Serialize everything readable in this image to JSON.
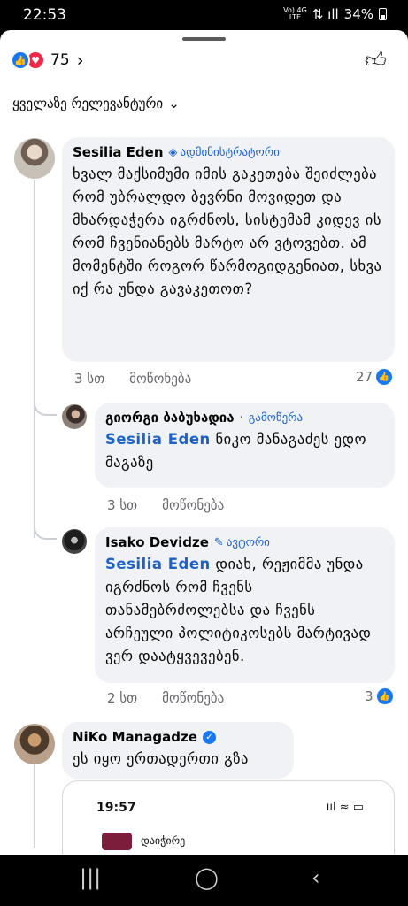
{
  "status_bar": {
    "time": "22:53",
    "net_top": "Vo) 4G",
    "net_bottom": "LTE",
    "battery": "34%"
  },
  "reactions": {
    "count": "75"
  },
  "sort": {
    "label": "ყველაზე რელევანტური"
  },
  "comments": [
    {
      "author": "Sesilia Eden",
      "badge": "ადმინისტრატორი",
      "text": "ხვალ მაქსიმუმი იმის გაკეთება შეიძლება რომ უბრალდო ბევრნი მოვიდეთ და მხარდაჭერა იგრძნოს, სისტემამ კიდევ ის რომ ჩვენიანებს მარტო არ ვტოვებთ. ამ მომენტში როგორ წარმოგიდგენიათ, სხვა იქ რა უნდა გავაკეთოთ?",
      "time": "3 სთ",
      "like": "მოწონება",
      "likes": "27"
    },
    {
      "author": "გიორგი ბაბუხადია",
      "badge": "გამოწერა",
      "mention": "Sesilia Eden",
      "text": " ნიკო მანაგაძეს ედო მაგაზე",
      "time": "3 სთ",
      "like": "მოწონება"
    },
    {
      "author": "Isako Devidze",
      "badge": "ავტორი",
      "mention": "Sesilia Eden",
      "text": " დიახ, რეჟიმმა უნდა იგრძნოს რომ ჩვენს თანამებრძოლებსა და ჩვენს არჩეული პოლიტიკოსებს მარტივად ვერ დაატყვევებენ.",
      "time": "2 სთ",
      "like": "მოწონება",
      "likes": "3"
    },
    {
      "author": "NiKo Managadze",
      "text": "ეს იყო ერთადერთი გზა"
    }
  ],
  "embedded_screenshot": {
    "time": "19:57",
    "app_label": "დაიჭირე"
  },
  "icons": {
    "like": "thumbs-up-icon",
    "love": "heart-icon",
    "admin": "diamond-shield-icon",
    "author": "pencil-icon",
    "verified": "verified-check-icon",
    "nav_recent": "recent-apps-icon",
    "nav_home": "home-icon",
    "nav_back": "back-icon"
  },
  "colors": {
    "link": "#1c62c9",
    "like_blue": "#1877f2",
    "love_red": "#f0284a",
    "bubble": "#f0f2f5"
  }
}
